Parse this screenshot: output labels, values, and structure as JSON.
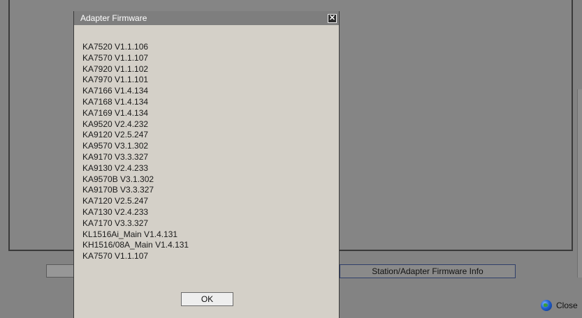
{
  "dialog": {
    "title": "Adapter Firmware",
    "close_glyph": "✕",
    "ok_label": "OK",
    "firmware": [
      "KA7520 V1.1.106",
      "KA7570 V1.1.107",
      "KA7920 V1.1.102",
      "KA7970 V1.1.101",
      "KA7166 V1.4.134",
      "KA7168 V1.4.134",
      "KA7169 V1.4.134",
      "KA9520 V2.4.232",
      "KA9120 V2.5.247",
      "KA9570 V3.1.302",
      "KA9170 V3.3.327",
      "KA9130 V2.4.233",
      "KA9570B V3.1.302",
      "KA9170B V3.3.327",
      "KA7120 V2.5.247",
      "KA7130 V2.4.233",
      "KA7170 V3.3.327",
      "KL1516Ai_Main V1.4.131",
      "KH1516/08A_Main V1.4.131",
      "KA7570 V1.1.107"
    ]
  },
  "background": {
    "info_button_label": "Station/Adapter Firmware Info",
    "close_label": "Close",
    "close_icon": "globe-icon"
  },
  "colors": {
    "dialog_bg": "#d4d0c8",
    "titlebar_bg": "#7e7e7e",
    "overlay_bg": "#838383"
  }
}
